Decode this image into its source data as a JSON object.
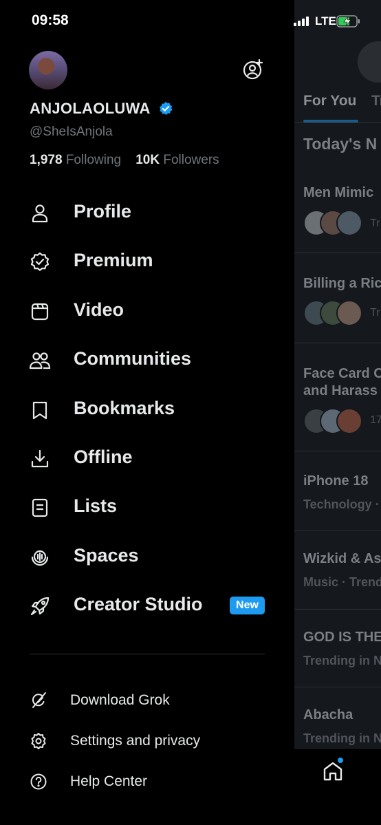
{
  "status_bar": {
    "time": "09:58",
    "network": "LTE",
    "icons": [
      "signal-icon",
      "battery-charging-icon"
    ]
  },
  "profile": {
    "display_name": "ANJOLAOLUWA",
    "handle": "@SheIsAnjola",
    "following_count": "1,978",
    "following_label": "Following",
    "followers_count": "10K",
    "followers_label": "Followers",
    "verified": true
  },
  "menu": [
    {
      "label": "Profile",
      "icon": "person-icon"
    },
    {
      "label": "Premium",
      "icon": "premium-badge-icon"
    },
    {
      "label": "Video",
      "icon": "video-icon"
    },
    {
      "label": "Communities",
      "icon": "communities-icon"
    },
    {
      "label": "Bookmarks",
      "icon": "bookmark-icon"
    },
    {
      "label": "Offline",
      "icon": "download-icon"
    },
    {
      "label": "Lists",
      "icon": "list-icon"
    },
    {
      "label": "Spaces",
      "icon": "spaces-icon"
    },
    {
      "label": "Creator Studio",
      "icon": "rocket-icon",
      "badge": "New"
    }
  ],
  "secondary_menu": [
    {
      "label": "Download Grok",
      "icon": "grok-icon"
    },
    {
      "label": "Settings and privacy",
      "icon": "gear-icon"
    },
    {
      "label": "Help Center",
      "icon": "help-icon"
    }
  ],
  "background_timeline": {
    "tabs": [
      "For You",
      "Tr"
    ],
    "section_heading": "Today's N",
    "items": [
      {
        "title": "Men Mimic",
        "meta": "Tr"
      },
      {
        "title": "Billing a Ric",
        "meta": "Tr"
      },
      {
        "title": "Face Card C",
        "title2": "and Harass",
        "meta": "17"
      },
      {
        "title": "iPhone 18",
        "meta": "Technology ·"
      },
      {
        "title": "Wizkid & As",
        "meta": "Music · Trend"
      },
      {
        "title": "GOD IS THE",
        "meta": "Trending in N"
      },
      {
        "title": "Abacha",
        "meta": "Trending in N"
      }
    ]
  },
  "colors": {
    "accent": "#1d9bf0",
    "background": "#000000",
    "muted": "#71767b"
  }
}
